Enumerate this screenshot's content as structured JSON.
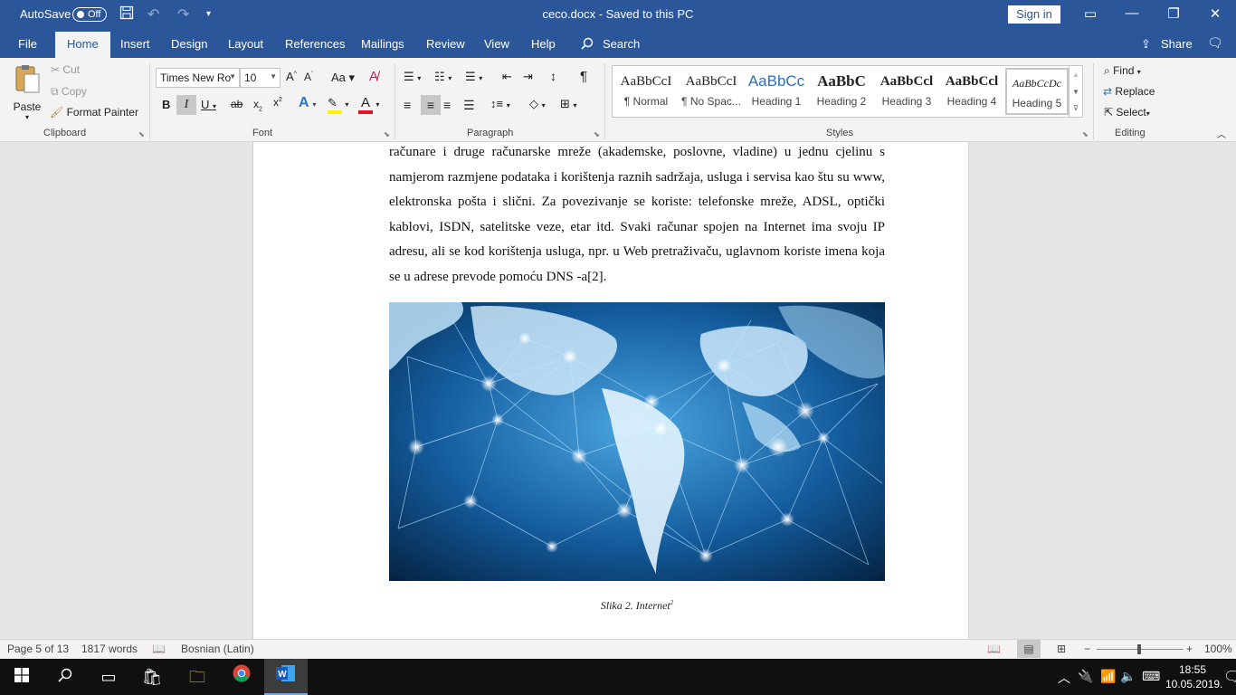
{
  "titlebar": {
    "autosave_label": "AutoSave",
    "autosave_state": "Off",
    "doc_title": "ceco.docx  -  Saved to this PC",
    "signin_label": "Sign in"
  },
  "tabs": [
    {
      "label": "File"
    },
    {
      "label": "Home"
    },
    {
      "label": "Insert"
    },
    {
      "label": "Design"
    },
    {
      "label": "Layout"
    },
    {
      "label": "References"
    },
    {
      "label": "Mailings"
    },
    {
      "label": "Review"
    },
    {
      "label": "View"
    },
    {
      "label": "Help"
    }
  ],
  "search_label": "Search",
  "share_label": "Share",
  "clipboard": {
    "paste": "Paste",
    "cut": "Cut",
    "copy": "Copy",
    "format_painter": "Format Painter",
    "group_label": "Clipboard"
  },
  "font": {
    "name": "Times New Ro",
    "size": "10",
    "group_label": "Font"
  },
  "paragraph": {
    "group_label": "Paragraph"
  },
  "styles": {
    "group_label": "Styles",
    "items": [
      {
        "preview": "AaBbCcI",
        "name": "¶ Normal"
      },
      {
        "preview": "AaBbCcI",
        "name": "¶ No Spac..."
      },
      {
        "preview": "AaBbCc",
        "name": "Heading 1"
      },
      {
        "preview": "AaBbC",
        "name": "Heading 2"
      },
      {
        "preview": "AaBbCcl",
        "name": "Heading 3"
      },
      {
        "preview": "AaBbCcl",
        "name": "Heading 4"
      },
      {
        "preview": "AaBbCcDc",
        "name": "Heading 5"
      }
    ]
  },
  "editing": {
    "find": "Find",
    "replace": "Replace",
    "select": "Select",
    "group_label": "Editing"
  },
  "document": {
    "paragraphs": [
      "računare  i druge računarske mreže (akademske, poslovne, vladine) u jednu cjelinu s namjerom razmjene podataka i korištenja raznih sadržaja, usluga i servisa kao štu su www, elektronska pošta i slični. Za povezivanje se koriste: telefonske mreže, ADSL, optički kablovi, ISDN, satelitske veze, etar itd. Svaki računar spojen na Internet ima svoju IP adresu, ali se kod korištenja usluga, npr. u Web pretraživaču, uglavnom koriste imena koja se u adrese prevode pomoću DNS -a[2]."
    ],
    "caption": "Slika 2. Internet",
    "caption_sup": "2"
  },
  "status": {
    "page": "Page 5 of 13",
    "words": "1817 words",
    "language": "Bosnian (Latin)",
    "zoom": "100%"
  },
  "taskbar": {
    "time": "18:55",
    "date": "10.05.2019."
  },
  "colors": {
    "word_blue": "#2b579a",
    "ribbon_bg": "#f3f3f3",
    "font_color_red": "#e81123",
    "highlight_yellow": "#fff200"
  }
}
